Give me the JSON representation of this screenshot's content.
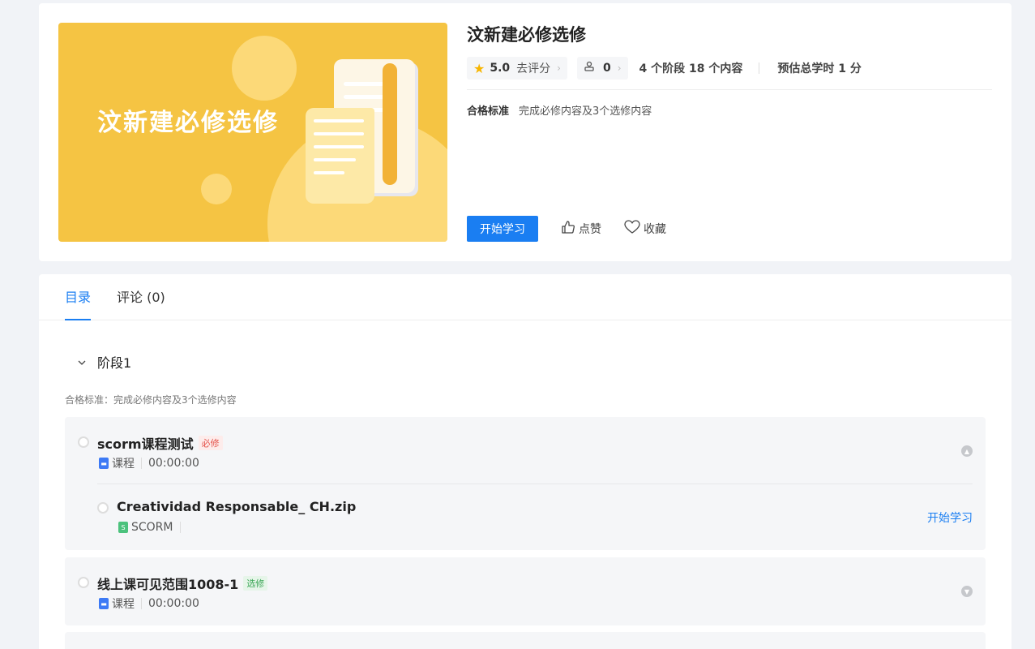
{
  "cover": {
    "title": "汶新建必修选修"
  },
  "course": {
    "title": "汶新建必修选修",
    "rating": "5.0",
    "rate_label": "去评分",
    "enroll_count": "0",
    "stages_text": "4 个阶段 18 个内容",
    "hours_text": "预估总学时 1 分",
    "criteria_label": "合格标准",
    "criteria_value": "完成必修内容及3个选修内容",
    "start_label": "开始学习",
    "like_label": "点赞",
    "fav_label": "收藏"
  },
  "tabs": [
    {
      "label": "目录"
    },
    {
      "label": "评论 (0)"
    }
  ],
  "stage": {
    "title": "阶段1",
    "criteria": "合格标准：完成必修内容及3个选修内容"
  },
  "items": [
    {
      "title": "scorm课程测试",
      "tag": "必修",
      "type": "课程",
      "duration": "00:00:00",
      "children": [
        {
          "title": "Creatividad Responsable_ CH.zip",
          "type": "SCORM",
          "action": "开始学习"
        }
      ]
    },
    {
      "title": "线上课可见范围1008-1",
      "tag": "选修",
      "type": "课程",
      "duration": "00:00:00"
    }
  ],
  "colors": {
    "accent": "#1a7ef2",
    "cover_bg": "#f5c443",
    "required": "#e5534b",
    "optional": "#3aa655"
  }
}
